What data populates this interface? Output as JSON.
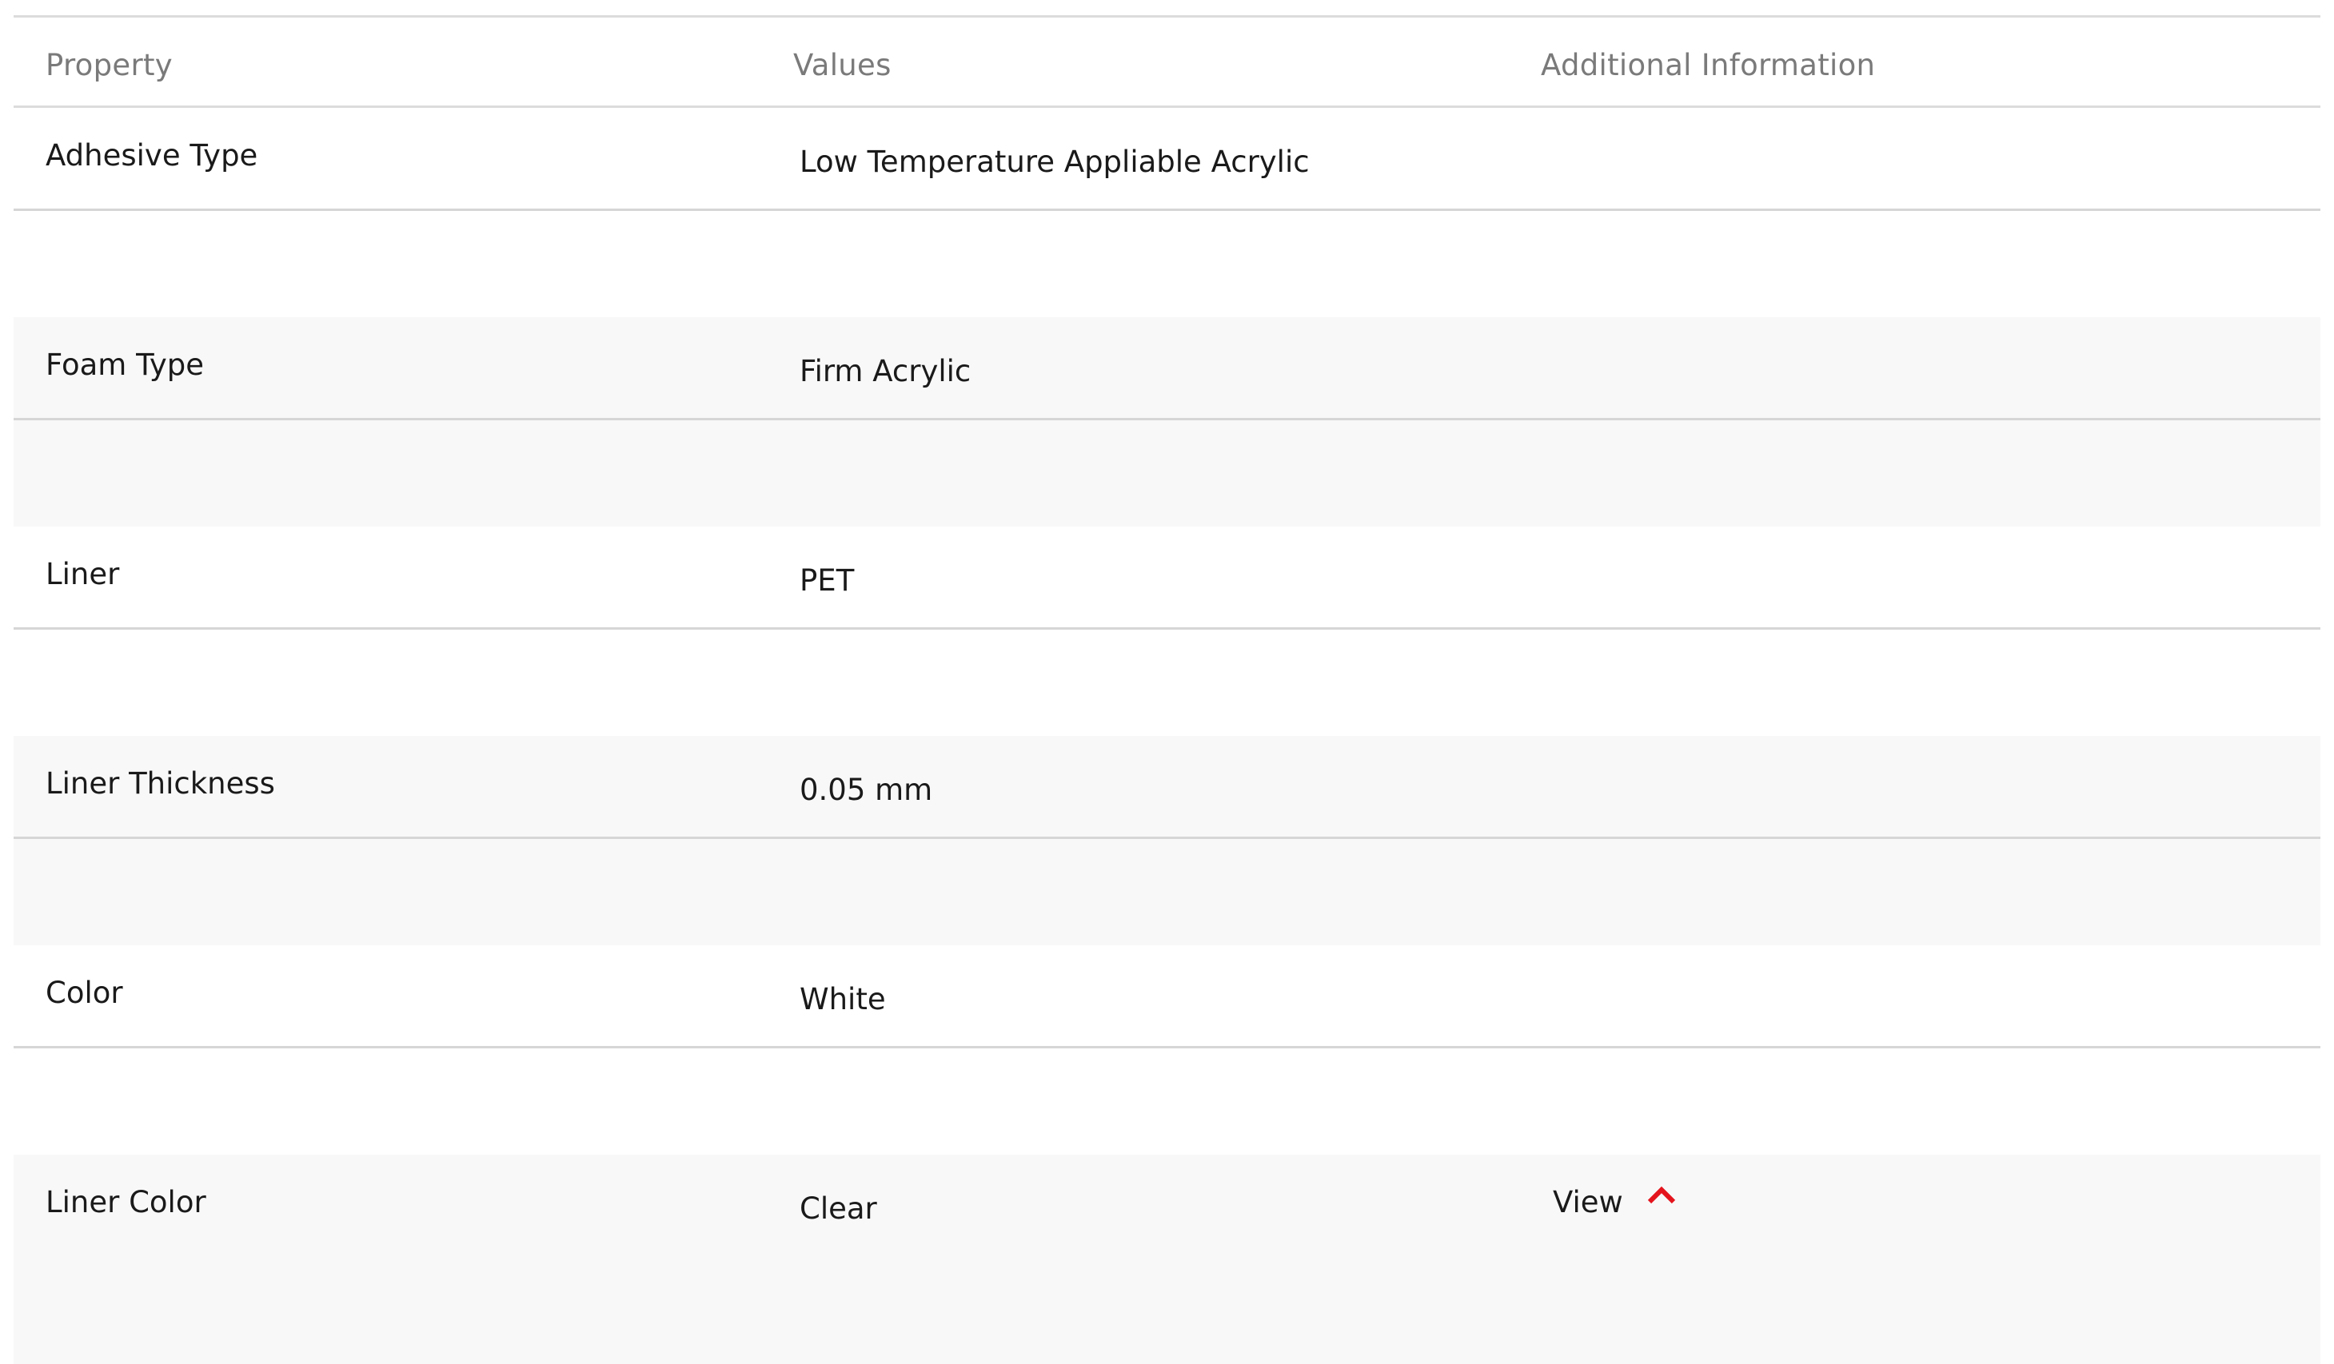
{
  "header": {
    "property": "Property",
    "values": "Values",
    "additional_information": "Additional Information"
  },
  "rows": [
    {
      "property": "Adhesive Type",
      "value": "Low Temperature Appliable Acrylic",
      "info": ""
    },
    {
      "property": "Foam Type",
      "value": "Firm Acrylic",
      "info": ""
    },
    {
      "property": "Liner",
      "value": "PET",
      "info": ""
    },
    {
      "property": "Liner Thickness",
      "value": "0.05 mm",
      "info": ""
    },
    {
      "property": "Color",
      "value": "White",
      "info": ""
    },
    {
      "property": "Liner Color",
      "value": "Clear",
      "info": "View",
      "info_icon": "chevron-up-icon"
    }
  ],
  "colors": {
    "accent": "#e4141d",
    "border": "#dcdcdc",
    "alt_row_bg": "#f8f8f8",
    "header_text": "#7a7a7a",
    "body_text": "#1a1a1a"
  }
}
